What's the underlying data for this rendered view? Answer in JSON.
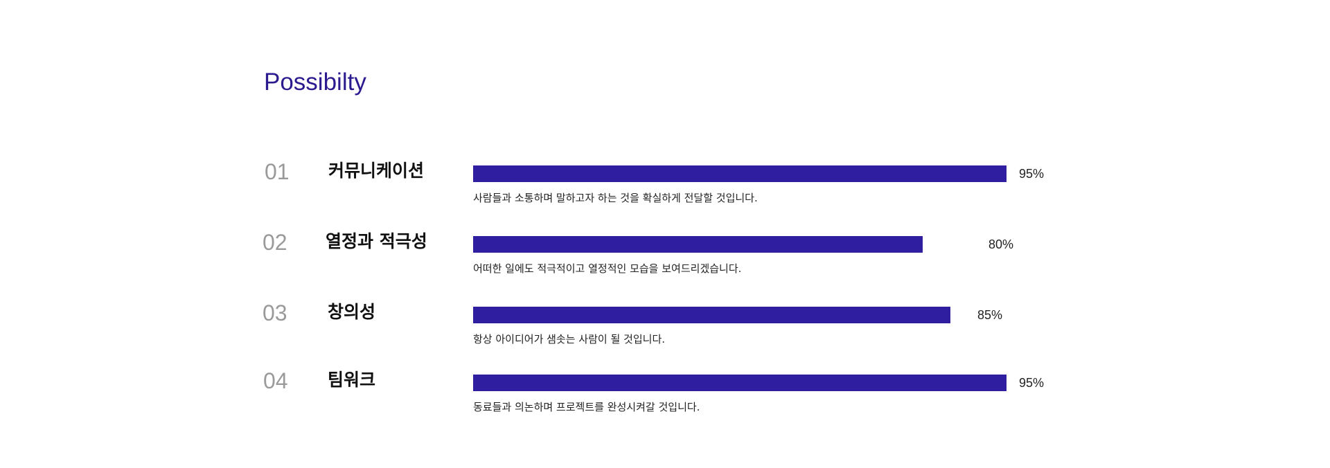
{
  "title": "Possibilty",
  "colors": {
    "accent": "#301ea0",
    "title": "#2b1b8f",
    "number": "#9a9a9a"
  },
  "skills": [
    {
      "number": "01",
      "label": "커뮤니케이션",
      "percent_text": "95%",
      "percent": 95,
      "description": "사람들과 소통하며 말하고자 하는 것을 확실하게 전달할 것입니다."
    },
    {
      "number": "02",
      "label": "열정과 적극성",
      "percent_text": "80%",
      "percent": 80,
      "description": "어떠한 일에도 적극적이고 열정적인 모습을 보여드리겠습니다."
    },
    {
      "number": "03",
      "label": "창의성",
      "percent_text": "85%",
      "percent": 85,
      "description": "항상 아이디어가 샘솟는 사람이 될 것입니다."
    },
    {
      "number": "04",
      "label": "팀워크",
      "percent_text": "95%",
      "percent": 95,
      "description": "동료들과 의논하며 프로젝트를 완성시켜갈 것입니다."
    }
  ]
}
